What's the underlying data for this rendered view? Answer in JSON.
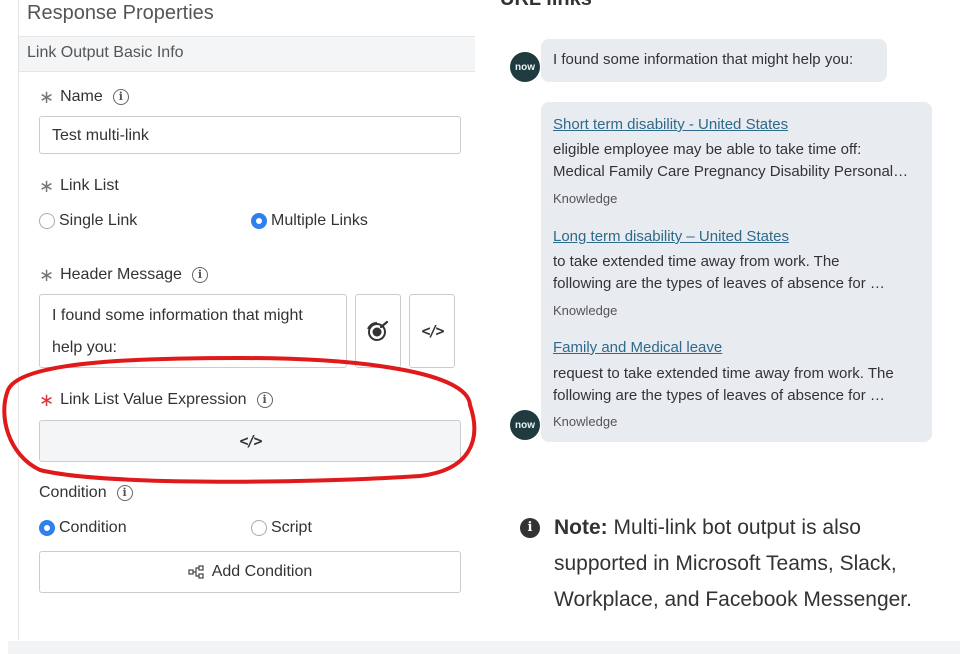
{
  "panel": {
    "title": "Response Properties",
    "section": "Link Output Basic Info",
    "name": {
      "label": "Name",
      "value": "Test multi-link"
    },
    "link_list": {
      "label": "Link List",
      "options": [
        "Single Link",
        "Multiple Links"
      ],
      "selected": "Multiple Links"
    },
    "header_message": {
      "label": "Header Message",
      "value_line1": "I found some information that might",
      "value_line2": "help you:"
    },
    "link_list_value_expression": {
      "label": "Link List Value Expression",
      "code_glyph": "</>"
    },
    "condition": {
      "label": "Condition",
      "options": [
        "Condition",
        "Script"
      ],
      "selected": "Condition",
      "add_button": "Add Condition"
    },
    "code_glyph": "</>"
  },
  "preview": {
    "heading": "URL links",
    "avatar_text": "now",
    "intro_message": "I found some information that might help you:",
    "links": [
      {
        "title": "Short term disability - United States",
        "line1": "eligible employee may be able to take time off:",
        "line2": "Medical Family Care Pregnancy Disability Personal…",
        "source": "Knowledge"
      },
      {
        "title": "Long term disability – United States",
        "line1": "to take extended time away from work. The",
        "line2": "following are the types of leaves of absence for …",
        "source": "Knowledge"
      },
      {
        "title": "Family and Medical leave",
        "line1": "request to take extended time away from work. The",
        "line2": "following are the types of leaves of absence for …",
        "source": "Knowledge"
      }
    ]
  },
  "note": {
    "bold": "Note:",
    "text": " Multi-link bot output is also supported in Microsoft Teams, Slack, Workplace, and Facebook Messenger."
  },
  "colors": {
    "accent_radio": "#2f80ed",
    "required_red": "#d9363e",
    "annotation_red": "#e0191b",
    "link": "#2e6a8a",
    "bubble": "#e8ebf0"
  }
}
